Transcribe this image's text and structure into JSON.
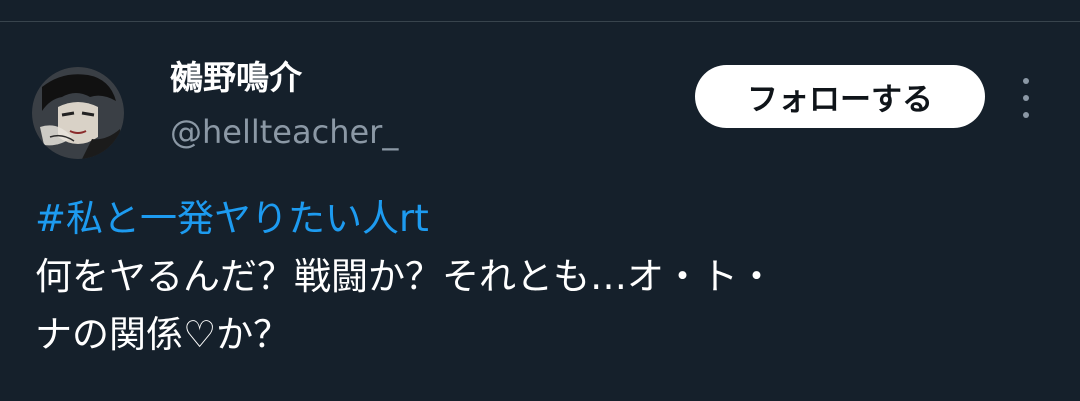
{
  "tweet": {
    "author": {
      "display_name": "鵺野鳴介",
      "handle": "@hellteacher_",
      "avatar_icon": "profile-avatar"
    },
    "follow_label": "フォローする",
    "more_icon": "more-vertical-icon",
    "hashtag": "#私と一発ヤりたい人rt",
    "body_lines": [
      "何をヤるんだ？戦闘か？それとも…オ・ト・",
      "ナの関係♡か？"
    ]
  },
  "colors": {
    "background": "#15202b",
    "link": "#1d9bf0",
    "secondary_text": "#8b98a5",
    "button_bg": "#ffffff"
  }
}
